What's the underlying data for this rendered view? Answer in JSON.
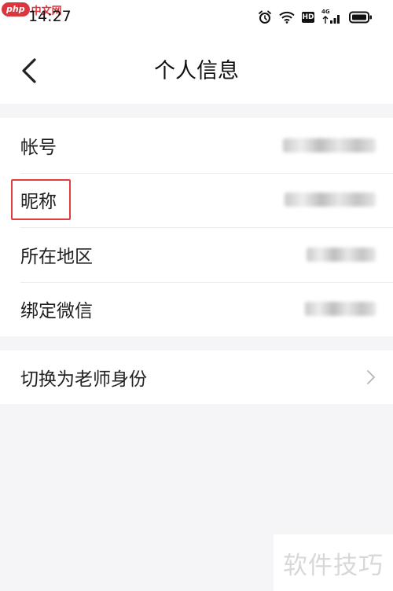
{
  "watermark": {
    "logo_pill": "php",
    "logo_text": "中文网",
    "bottom_text": "软件技巧"
  },
  "status_bar": {
    "time": "14:27",
    "network_type": "4G",
    "hd_label": "HD",
    "icons": [
      "alarm-icon",
      "wifi-icon",
      "hd-icon",
      "signal-icon",
      "battery-icon"
    ]
  },
  "nav": {
    "title": "个人信息",
    "back_icon": "chevron-left-icon"
  },
  "profile_rows": [
    {
      "label": "帐号"
    },
    {
      "label": "昵称"
    },
    {
      "label": "所在地区"
    },
    {
      "label": "绑定微信"
    }
  ],
  "switch_row": {
    "label": "切换为老师身份",
    "icon": "chevron-right-icon"
  },
  "colors": {
    "highlight": "#e03e3e",
    "page_background": "#f5f5f7",
    "card": "#ffffff"
  }
}
